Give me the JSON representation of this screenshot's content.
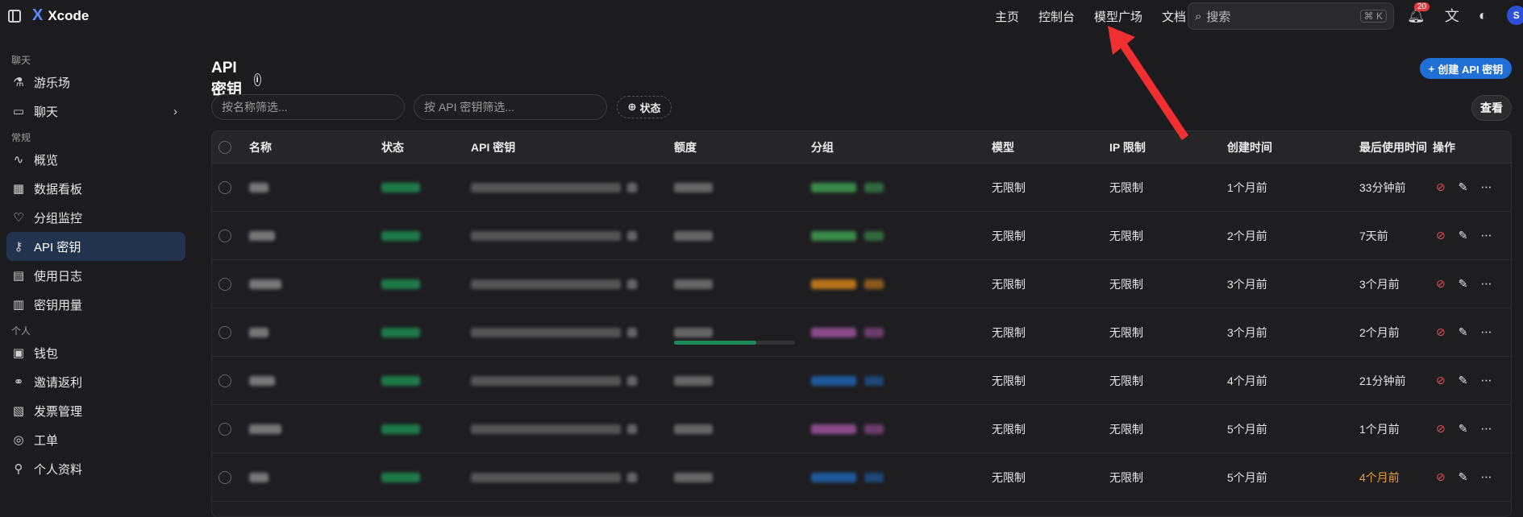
{
  "brand": {
    "name": "Xcode",
    "logo": "X"
  },
  "nav": [
    "主页",
    "控制台",
    "模型广场",
    "文档"
  ],
  "search": {
    "placeholder": "搜索",
    "shortcut": "⌘ K"
  },
  "notifications": {
    "count": "20"
  },
  "avatar": {
    "initial": "S"
  },
  "sidebar": {
    "sections": [
      {
        "label": "聊天",
        "items": [
          {
            "label": "游乐场",
            "icon": "flask-icon"
          },
          {
            "label": "聊天",
            "icon": "chat-icon",
            "chevron": true
          }
        ]
      },
      {
        "label": "常规",
        "items": [
          {
            "label": "概览",
            "icon": "activity-icon"
          },
          {
            "label": "数据看板",
            "icon": "dashboard-icon"
          },
          {
            "label": "分组监控",
            "icon": "heart-monitor-icon"
          },
          {
            "label": "API 密钥",
            "icon": "key-icon",
            "active": true
          },
          {
            "label": "使用日志",
            "icon": "log-icon"
          },
          {
            "label": "密钥用量",
            "icon": "usage-icon"
          }
        ]
      },
      {
        "label": "个人",
        "items": [
          {
            "label": "钱包",
            "icon": "wallet-icon"
          },
          {
            "label": "邀请返利",
            "icon": "handshake-icon"
          },
          {
            "label": "发票管理",
            "icon": "invoice-icon"
          },
          {
            "label": "工单",
            "icon": "ticket-icon"
          },
          {
            "label": "个人资料",
            "icon": "user-icon"
          }
        ]
      }
    ]
  },
  "page": {
    "title": "API 密钥",
    "create_label": "创建 API 密钥",
    "view_label": "查看"
  },
  "filters": {
    "name_placeholder": "按名称筛选...",
    "key_placeholder": "按 API 密钥筛选...",
    "status_label": "状态"
  },
  "table": {
    "columns": [
      "名称",
      "状态",
      "API 密钥",
      "额度",
      "分组",
      "模型",
      "IP 限制",
      "创建时间",
      "最后使用时间",
      "操作"
    ],
    "rows": [
      {
        "model": "无限制",
        "ip": "无限制",
        "created": "1个月前",
        "last_used": "33分钟前",
        "warn": false,
        "group_color": "#3a8a4a"
      },
      {
        "model": "无限制",
        "ip": "无限制",
        "created": "2个月前",
        "last_used": "7天前",
        "warn": false,
        "group_color": "#3a8a4a"
      },
      {
        "model": "无限制",
        "ip": "无限制",
        "created": "3个月前",
        "last_used": "3个月前",
        "warn": false,
        "group_color": "#b8741a"
      },
      {
        "model": "无限制",
        "ip": "无限制",
        "created": "3个月前",
        "last_used": "2个月前",
        "warn": false,
        "group_color": "#8a4a8a",
        "quota_bar": 0.68
      },
      {
        "model": "无限制",
        "ip": "无限制",
        "created": "4个月前",
        "last_used": "21分钟前",
        "warn": false,
        "group_color": "#1e5a9a"
      },
      {
        "model": "无限制",
        "ip": "无限制",
        "created": "5个月前",
        "last_used": "1个月前",
        "warn": false,
        "group_color": "#8a4a8a"
      },
      {
        "model": "无限制",
        "ip": "无限制",
        "created": "5个月前",
        "last_used": "4个月前",
        "warn": true,
        "group_color": "#1e5a9a"
      }
    ]
  },
  "colors": {
    "accent": "#1f6fd6",
    "active_bg": "#22344d",
    "danger": "#e05252",
    "warn": "#f0a030",
    "status_green": "#1e7a4a"
  }
}
